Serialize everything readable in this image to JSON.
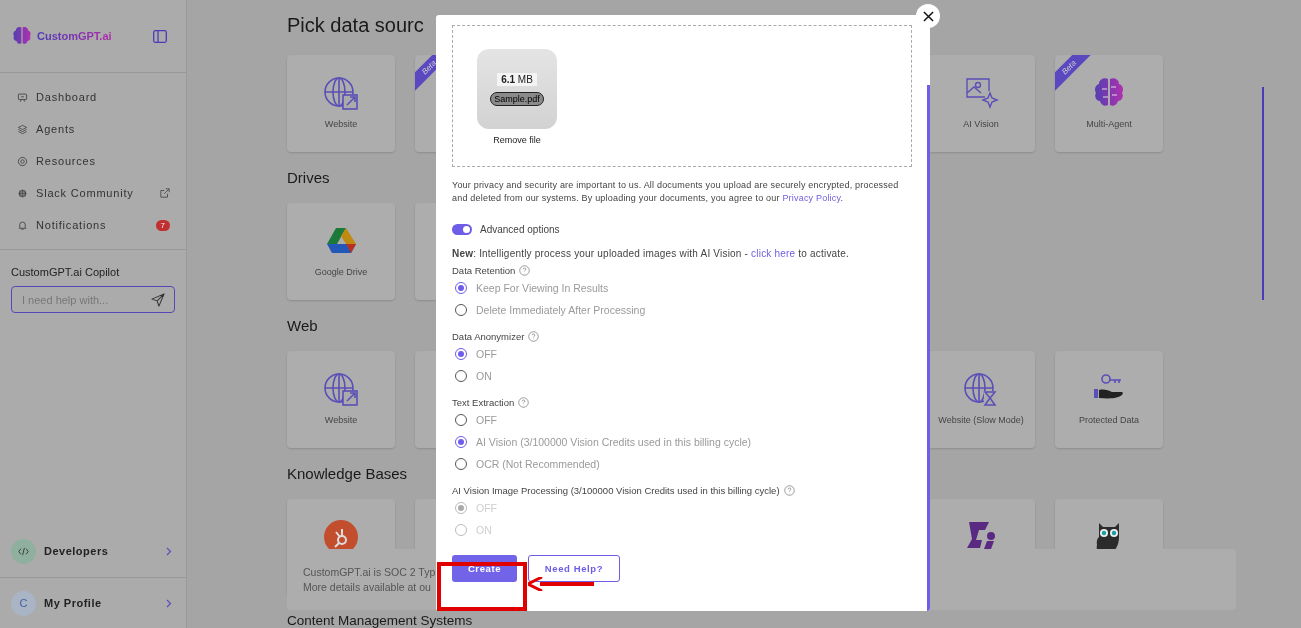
{
  "sidebar": {
    "brand": "CustomGPT.ai",
    "nav": [
      {
        "label": "Dashboard"
      },
      {
        "label": "Agents"
      },
      {
        "label": "Resources"
      },
      {
        "label": "Slack Community",
        "external": true
      },
      {
        "label": "Notifications",
        "badge": "7"
      }
    ],
    "copilot": {
      "title": "CustomGPT.ai Copilot",
      "placeholder": "I need help with..."
    },
    "developers": {
      "label": "Developers"
    },
    "profile": {
      "avatar": "C",
      "label": "My Profile"
    }
  },
  "main": {
    "title": "Pick data sourc",
    "sections": [
      {
        "cards": [
          {
            "kind": "globe",
            "label": "Website"
          },
          {
            "kind": "blank",
            "beta": "Beta"
          }
        ],
        "cards_right": [
          {
            "kind": "vision",
            "label": "AI Vision"
          },
          {
            "kind": "brain",
            "label": "Multi-Agent",
            "beta": "Beta"
          }
        ]
      },
      {
        "title": "Drives",
        "cards": [
          {
            "kind": "drive",
            "label": "Google Drive"
          }
        ]
      },
      {
        "title": "Web",
        "cards": [
          {
            "kind": "globe",
            "label": "Website"
          }
        ],
        "cards_right": [
          {
            "kind": "hourglass",
            "label": "Website (Slow Mode)"
          },
          {
            "kind": "key",
            "label": "Protected Data"
          }
        ]
      },
      {
        "title": "Knowledge Bases",
        "cards": [
          {
            "kind": "hubspot"
          }
        ],
        "cards_right": [
          {
            "kind": "dlogo"
          },
          {
            "kind": "owl"
          }
        ]
      },
      {
        "title": "Content Management Systems"
      }
    ],
    "banner": [
      "CustomGPT.ai is SOC 2 Typ",
      "More details available at ou"
    ]
  },
  "modal": {
    "file": {
      "size": "**6.1** MB",
      "name": "Sample.pdf",
      "remove": "Remove file"
    },
    "privacy": {
      "text": "Your privacy and security are important to us. All documents you upload are securely encrypted, processed and deleted from our systems. By uploading your documents, you agree to our ",
      "link": "Privacy Policy",
      "after": "."
    },
    "advanced": {
      "label": "Advanced options",
      "on": true
    },
    "notice": {
      "text": "**New**: Intelligently process your uploaded images with AI Vision - ",
      "link": "click here",
      "after": " to activate."
    },
    "groups": [
      {
        "label": "Data Retention",
        "options": [
          {
            "label": "Keep For Viewing In Results",
            "selected": true,
            "disabled": false
          },
          {
            "label": "Delete Immediately After Processing",
            "selected": false,
            "disabled": false
          }
        ]
      },
      {
        "label": "Data Anonymizer",
        "options": [
          {
            "label": "OFF",
            "selected": true,
            "disabled": false
          },
          {
            "label": "ON",
            "selected": false,
            "disabled": false
          }
        ]
      },
      {
        "label": "Text Extraction",
        "options": [
          {
            "label": "OFF",
            "selected": false,
            "disabled": false
          },
          {
            "label": "AI Vision (3/100000 Vision Credits used in this billing cycle)",
            "selected": true,
            "disabled": false
          },
          {
            "label": "OCR (Not Recommended)",
            "selected": false,
            "disabled": false
          }
        ]
      },
      {
        "label": "AI Vision Image Processing (3/100000 Vision Credits used in this billing cycle)",
        "options": [
          {
            "label": "OFF",
            "selected": true,
            "disabled": true
          },
          {
            "label": "ON",
            "selected": false,
            "disabled": true
          }
        ]
      }
    ],
    "buttons": {
      "primary": "Create",
      "secondary": "Need Help?"
    }
  }
}
